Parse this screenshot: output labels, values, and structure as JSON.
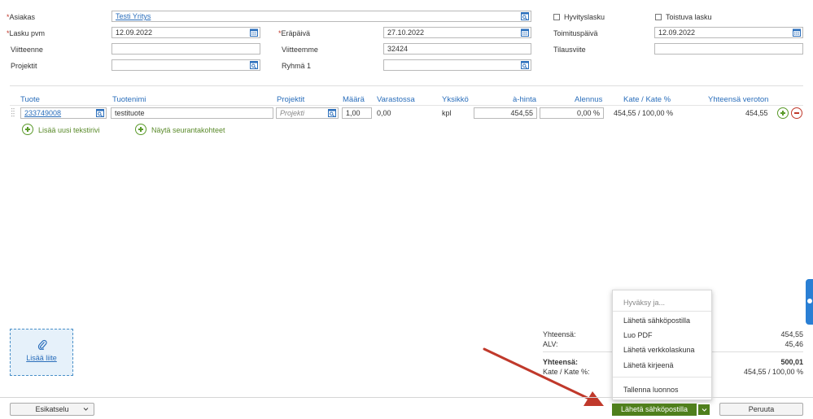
{
  "header": {
    "customer_label": "Asiakas",
    "customer_value": "Testi Yritys",
    "credit_invoice_label": "Hyvityslasku",
    "recurring_invoice_label": "Toistuva lasku",
    "invoice_date_label": "Lasku pvm",
    "invoice_date_value": "12.09.2022",
    "due_date_label": "Eräpäivä",
    "due_date_value": "27.10.2022",
    "delivery_date_label": "Toimituspäivä",
    "delivery_date_value": "12.09.2022",
    "your_ref_label": "Viitteenne",
    "your_ref_value": "",
    "our_ref_label": "Viitteemme",
    "our_ref_value": "32424",
    "order_ref_label": "Tilausviite",
    "order_ref_value": "",
    "projects_label": "Projektit",
    "projects_value": "",
    "group_label": "Ryhmä 1",
    "group_value": "",
    "required_mark": "*"
  },
  "table": {
    "columns": [
      "Tuote",
      "Tuotenimi",
      "Projektit",
      "Määrä",
      "Varastossa",
      "Yksikkö",
      "à-hinta",
      "Alennus",
      "Kate / Kate %",
      "Yhteensä veroton"
    ],
    "rows": [
      {
        "product": "233749008",
        "product_name": "testituote",
        "project_placeholder": "Projekti",
        "quantity": "1,00",
        "in_stock": "0,00",
        "unit": "kpl",
        "unit_price": "454,55",
        "discount": "0,00 %",
        "margin": "454,55 / 100,00 %",
        "total": "454,55"
      }
    ],
    "add_text_row": "Lisää uusi tekstirivi",
    "show_tracking": "Näytä seurantakohteet"
  },
  "attachment": {
    "label": "Lisää liite"
  },
  "totals": {
    "subtotal_label": "Yhteensä:",
    "subtotal_value": "454,55",
    "vat_label": "ALV:",
    "vat_value": "45,46",
    "total_label": "Yhteensä:",
    "total_value": "500,01",
    "margin_label": "Kate / Kate %:",
    "margin_value": "454,55 / 100,00 %"
  },
  "menu": {
    "items": [
      "Hyväksy ja...",
      "Lähetä sähköpostilla",
      "Luo PDF",
      "Lähetä verkkolaskuna",
      "Lähetä kirjeenä",
      "Tallenna luonnos"
    ]
  },
  "footer": {
    "preview_label": "Esikatselu",
    "send_email_label": "Lähetä sähköpostilla",
    "cancel_label": "Peruuta"
  },
  "colors": {
    "link": "#2a6ebb",
    "primary_button": "#4f7f1c",
    "add_green": "#5a9a2a",
    "remove_red": "#c0392b",
    "arrow": "#c0392b",
    "side_tab": "#2a7fd4"
  },
  "icons": [
    "search-list-icon",
    "calendar-icon",
    "paperclip-icon",
    "add-circle-icon",
    "remove-circle-icon",
    "chevron-down-icon",
    "drag-handle-icon"
  ]
}
